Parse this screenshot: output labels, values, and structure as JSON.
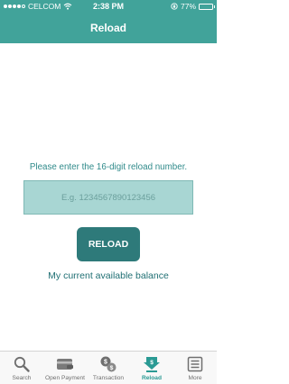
{
  "status_bar": {
    "carrier": "CELCOM",
    "time": "2:38 PM",
    "battery": "77%",
    "battery_level": 0.77,
    "signal_bars": 4
  },
  "nav": {
    "title": "Reload"
  },
  "main": {
    "prompt": "Please enter the 16-digit reload number.",
    "input_value": "",
    "input_placeholder": "E.g. 1234567890123456",
    "reload_button": "RELOAD",
    "balance_link": "My current available balance"
  },
  "tabs": [
    {
      "label": "Search",
      "icon": "search-icon"
    },
    {
      "label": "Open Payment",
      "icon": "wallet-icon"
    },
    {
      "label": "Transaction",
      "icon": "transaction-icon"
    },
    {
      "label": "Reload",
      "icon": "reload-icon",
      "active": true
    },
    {
      "label": "More",
      "icon": "more-icon"
    }
  ],
  "colors": {
    "accent": "#41a39a",
    "button": "#2e7a7a",
    "active_tab": "#2a9a94"
  }
}
